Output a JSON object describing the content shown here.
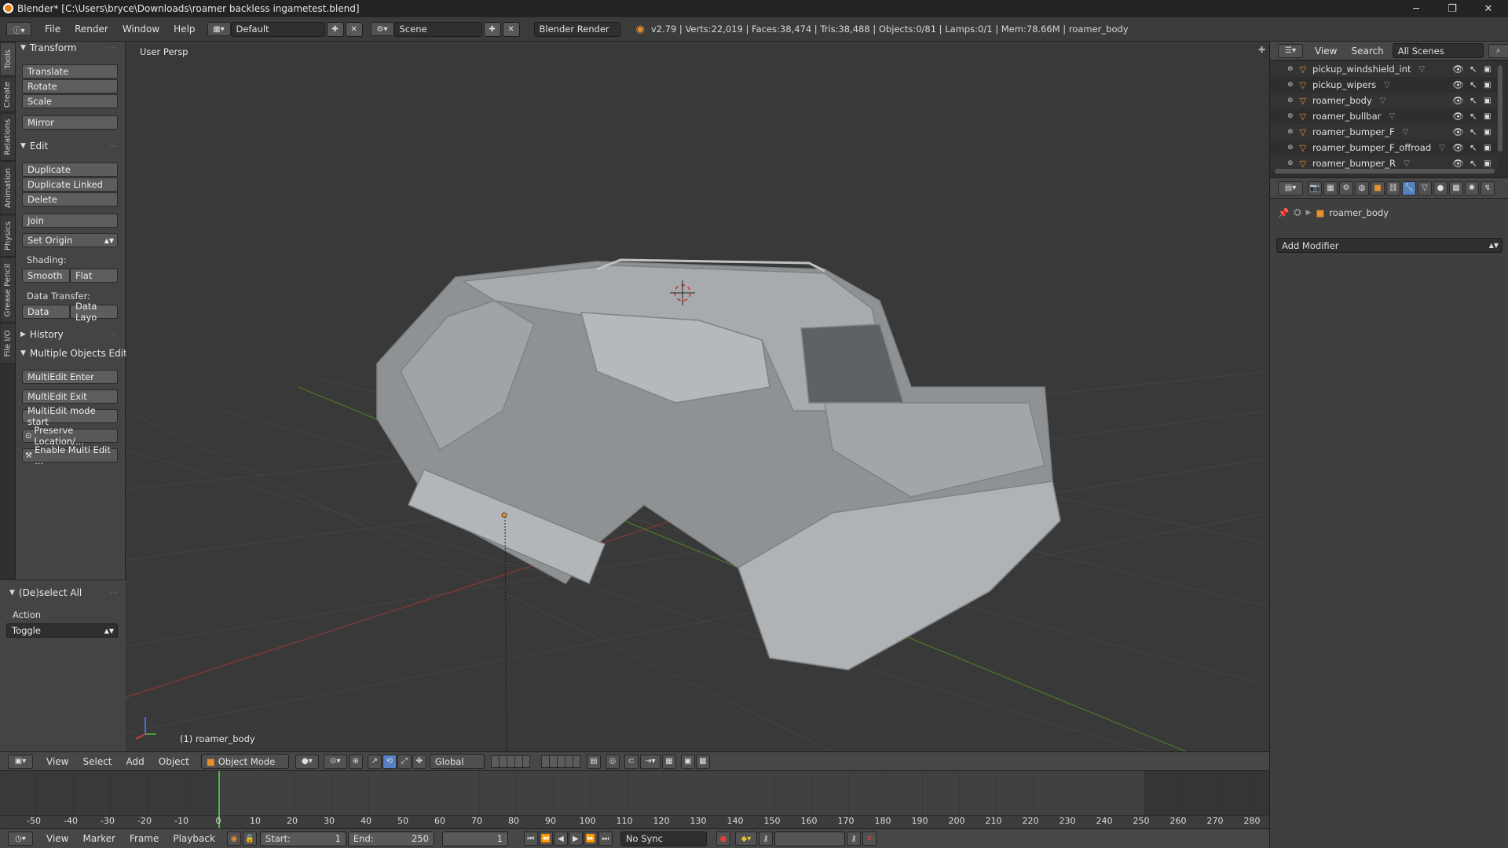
{
  "window": {
    "title": "Blender* [C:\\Users\\bryce\\Downloads\\roamer backless ingametest.blend]",
    "minimize_glyph": "─",
    "maximize_glyph": "❐",
    "close_glyph": "✕"
  },
  "infobar": {
    "menus": [
      "File",
      "Render",
      "Window",
      "Help"
    ],
    "layout": "Default",
    "scene": "Scene",
    "engine": "Blender Render",
    "stats": "v2.79 | Verts:22,019 | Faces:38,474 | Tris:38,488 | Objects:0/81 | Lamps:0/1 | Mem:78.66M | roamer_body"
  },
  "tabs": [
    "Tools",
    "Create",
    "Relations",
    "Animation",
    "Physics",
    "Grease Pencil",
    "File I/O"
  ],
  "toolshelf": {
    "transform": {
      "title": "Transform",
      "buttons": [
        "Translate",
        "Rotate",
        "Scale",
        "Mirror"
      ]
    },
    "edit": {
      "title": "Edit",
      "buttons": [
        "Duplicate",
        "Duplicate Linked",
        "Delete",
        "Join"
      ],
      "set_origin": "Set Origin",
      "shading_label": "Shading:",
      "smooth": "Smooth",
      "flat": "Flat",
      "data_transfer_label": "Data Transfer:",
      "data": "Data",
      "data_layo": "Data Layo"
    },
    "history": {
      "title": "History"
    },
    "multi": {
      "title": "Multiple Objects Edit",
      "buttons": [
        "MultiEdit Enter",
        "MultiEdit Exit",
        "MultiEdit mode start",
        "Preserve Location/...",
        "Enable Multi Edit ..."
      ]
    },
    "operator": {
      "title": "(De)select All",
      "action_label": "Action",
      "action_value": "Toggle"
    }
  },
  "viewport": {
    "view_name": "User Persp",
    "object_label": "(1) roamer_body"
  },
  "viewport_header": {
    "menus": [
      "View",
      "Select",
      "Add",
      "Object"
    ],
    "mode": "Object Mode",
    "orientation": "Global"
  },
  "timeline": {
    "ticks": [
      -50,
      -40,
      -30,
      -20,
      -10,
      0,
      10,
      20,
      30,
      40,
      50,
      60,
      70,
      80,
      90,
      100,
      110,
      120,
      130,
      140,
      150,
      160,
      170,
      180,
      190,
      200,
      210,
      220,
      230,
      240,
      250,
      260,
      270,
      280
    ],
    "current_frame": 1,
    "start_label": "Start:",
    "start": 1,
    "end_label": "End:",
    "end": 250,
    "frame": 1,
    "menus": [
      "View",
      "Marker",
      "Frame",
      "Playback"
    ],
    "sync": "No Sync"
  },
  "outliner": {
    "view_menu": "View",
    "search_menu": "Search",
    "scenes": "All Scenes",
    "items": [
      "pickup_windshield_int",
      "pickup_wipers",
      "roamer_body",
      "roamer_bullbar",
      "roamer_bumper_F",
      "roamer_bumper_F_offroad",
      "roamer_bumper_R"
    ]
  },
  "properties": {
    "context_object": "roamer_body",
    "add_modifier": "Add Modifier"
  },
  "colors": {
    "accent_blue": "#5680c2",
    "grid_red": "#8b3535",
    "grid_green": "#4a7a2a",
    "orange": "#e89030"
  }
}
